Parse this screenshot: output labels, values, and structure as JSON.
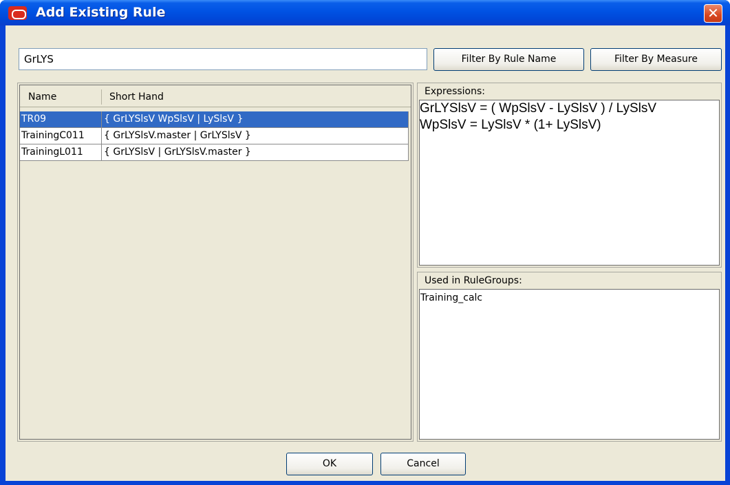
{
  "window": {
    "title": "Add Existing Rule",
    "close_glyph": "✕"
  },
  "filter": {
    "value": "GrLYS",
    "by_rule_name_label": "Filter By Rule Name",
    "by_measure_label": "Filter By Measure"
  },
  "rules_table": {
    "columns": [
      "Name",
      "Short Hand"
    ],
    "rows": [
      {
        "name": "TR09",
        "short_hand": "{ GrLYSlsV WpSlsV | LySlsV }",
        "selected": true
      },
      {
        "name": "TrainingC011",
        "short_hand": "{ GrLYSlsV.master | GrLYSlsV }",
        "selected": false
      },
      {
        "name": "TrainingL011",
        "short_hand": "{ GrLYSlsV | GrLYSlsV.master }",
        "selected": false
      }
    ]
  },
  "expressions": {
    "label": "Expressions:",
    "lines": [
      "GrLYSlsV = ( WpSlsV - LySlsV ) / LySlsV",
      "WpSlsV = LySlsV * (1+ LySlsV)"
    ]
  },
  "used_in": {
    "label": "Used in RuleGroups:",
    "items": [
      "Training_calc"
    ]
  },
  "footer": {
    "ok_label": "OK",
    "cancel_label": "Cancel"
  },
  "colors": {
    "title_bar": "#0052e3",
    "dialog_face": "#ece9d8",
    "selection": "#316ac5",
    "close_button": "#d8461f",
    "brand_icon": "#d92b1e"
  },
  "icons": {
    "app": "oracle-logo-icon",
    "close": "close-icon"
  }
}
